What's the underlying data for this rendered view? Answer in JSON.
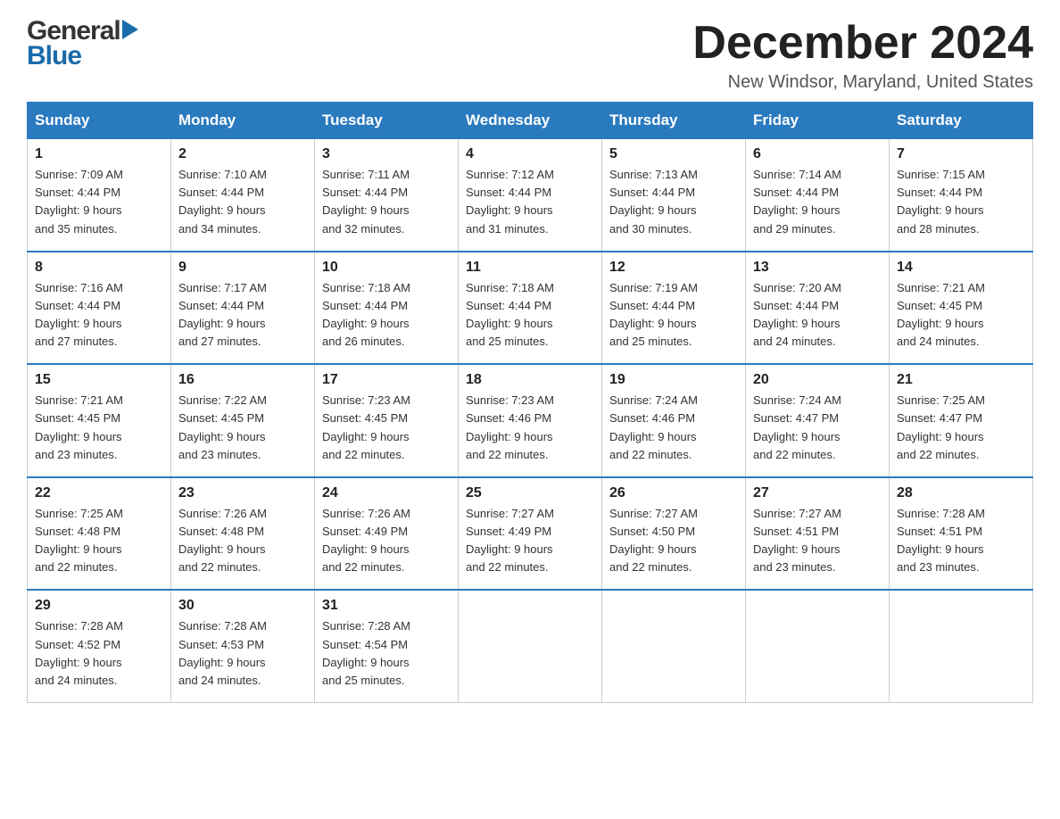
{
  "header": {
    "logo_general": "General",
    "logo_blue": "Blue",
    "month_title": "December 2024",
    "location": "New Windsor, Maryland, United States"
  },
  "days_of_week": [
    "Sunday",
    "Monday",
    "Tuesday",
    "Wednesday",
    "Thursday",
    "Friday",
    "Saturday"
  ],
  "weeks": [
    [
      {
        "day": "1",
        "sunrise": "7:09 AM",
        "sunset": "4:44 PM",
        "daylight": "9 hours and 35 minutes."
      },
      {
        "day": "2",
        "sunrise": "7:10 AM",
        "sunset": "4:44 PM",
        "daylight": "9 hours and 34 minutes."
      },
      {
        "day": "3",
        "sunrise": "7:11 AM",
        "sunset": "4:44 PM",
        "daylight": "9 hours and 32 minutes."
      },
      {
        "day": "4",
        "sunrise": "7:12 AM",
        "sunset": "4:44 PM",
        "daylight": "9 hours and 31 minutes."
      },
      {
        "day": "5",
        "sunrise": "7:13 AM",
        "sunset": "4:44 PM",
        "daylight": "9 hours and 30 minutes."
      },
      {
        "day": "6",
        "sunrise": "7:14 AM",
        "sunset": "4:44 PM",
        "daylight": "9 hours and 29 minutes."
      },
      {
        "day": "7",
        "sunrise": "7:15 AM",
        "sunset": "4:44 PM",
        "daylight": "9 hours and 28 minutes."
      }
    ],
    [
      {
        "day": "8",
        "sunrise": "7:16 AM",
        "sunset": "4:44 PM",
        "daylight": "9 hours and 27 minutes."
      },
      {
        "day": "9",
        "sunrise": "7:17 AM",
        "sunset": "4:44 PM",
        "daylight": "9 hours and 27 minutes."
      },
      {
        "day": "10",
        "sunrise": "7:18 AM",
        "sunset": "4:44 PM",
        "daylight": "9 hours and 26 minutes."
      },
      {
        "day": "11",
        "sunrise": "7:18 AM",
        "sunset": "4:44 PM",
        "daylight": "9 hours and 25 minutes."
      },
      {
        "day": "12",
        "sunrise": "7:19 AM",
        "sunset": "4:44 PM",
        "daylight": "9 hours and 25 minutes."
      },
      {
        "day": "13",
        "sunrise": "7:20 AM",
        "sunset": "4:44 PM",
        "daylight": "9 hours and 24 minutes."
      },
      {
        "day": "14",
        "sunrise": "7:21 AM",
        "sunset": "4:45 PM",
        "daylight": "9 hours and 24 minutes."
      }
    ],
    [
      {
        "day": "15",
        "sunrise": "7:21 AM",
        "sunset": "4:45 PM",
        "daylight": "9 hours and 23 minutes."
      },
      {
        "day": "16",
        "sunrise": "7:22 AM",
        "sunset": "4:45 PM",
        "daylight": "9 hours and 23 minutes."
      },
      {
        "day": "17",
        "sunrise": "7:23 AM",
        "sunset": "4:45 PM",
        "daylight": "9 hours and 22 minutes."
      },
      {
        "day": "18",
        "sunrise": "7:23 AM",
        "sunset": "4:46 PM",
        "daylight": "9 hours and 22 minutes."
      },
      {
        "day": "19",
        "sunrise": "7:24 AM",
        "sunset": "4:46 PM",
        "daylight": "9 hours and 22 minutes."
      },
      {
        "day": "20",
        "sunrise": "7:24 AM",
        "sunset": "4:47 PM",
        "daylight": "9 hours and 22 minutes."
      },
      {
        "day": "21",
        "sunrise": "7:25 AM",
        "sunset": "4:47 PM",
        "daylight": "9 hours and 22 minutes."
      }
    ],
    [
      {
        "day": "22",
        "sunrise": "7:25 AM",
        "sunset": "4:48 PM",
        "daylight": "9 hours and 22 minutes."
      },
      {
        "day": "23",
        "sunrise": "7:26 AM",
        "sunset": "4:48 PM",
        "daylight": "9 hours and 22 minutes."
      },
      {
        "day": "24",
        "sunrise": "7:26 AM",
        "sunset": "4:49 PM",
        "daylight": "9 hours and 22 minutes."
      },
      {
        "day": "25",
        "sunrise": "7:27 AM",
        "sunset": "4:49 PM",
        "daylight": "9 hours and 22 minutes."
      },
      {
        "day": "26",
        "sunrise": "7:27 AM",
        "sunset": "4:50 PM",
        "daylight": "9 hours and 22 minutes."
      },
      {
        "day": "27",
        "sunrise": "7:27 AM",
        "sunset": "4:51 PM",
        "daylight": "9 hours and 23 minutes."
      },
      {
        "day": "28",
        "sunrise": "7:28 AM",
        "sunset": "4:51 PM",
        "daylight": "9 hours and 23 minutes."
      }
    ],
    [
      {
        "day": "29",
        "sunrise": "7:28 AM",
        "sunset": "4:52 PM",
        "daylight": "9 hours and 24 minutes."
      },
      {
        "day": "30",
        "sunrise": "7:28 AM",
        "sunset": "4:53 PM",
        "daylight": "9 hours and 24 minutes."
      },
      {
        "day": "31",
        "sunrise": "7:28 AM",
        "sunset": "4:54 PM",
        "daylight": "9 hours and 25 minutes."
      },
      null,
      null,
      null,
      null
    ]
  ],
  "labels": {
    "sunrise": "Sunrise:",
    "sunset": "Sunset:",
    "daylight": "Daylight:"
  }
}
